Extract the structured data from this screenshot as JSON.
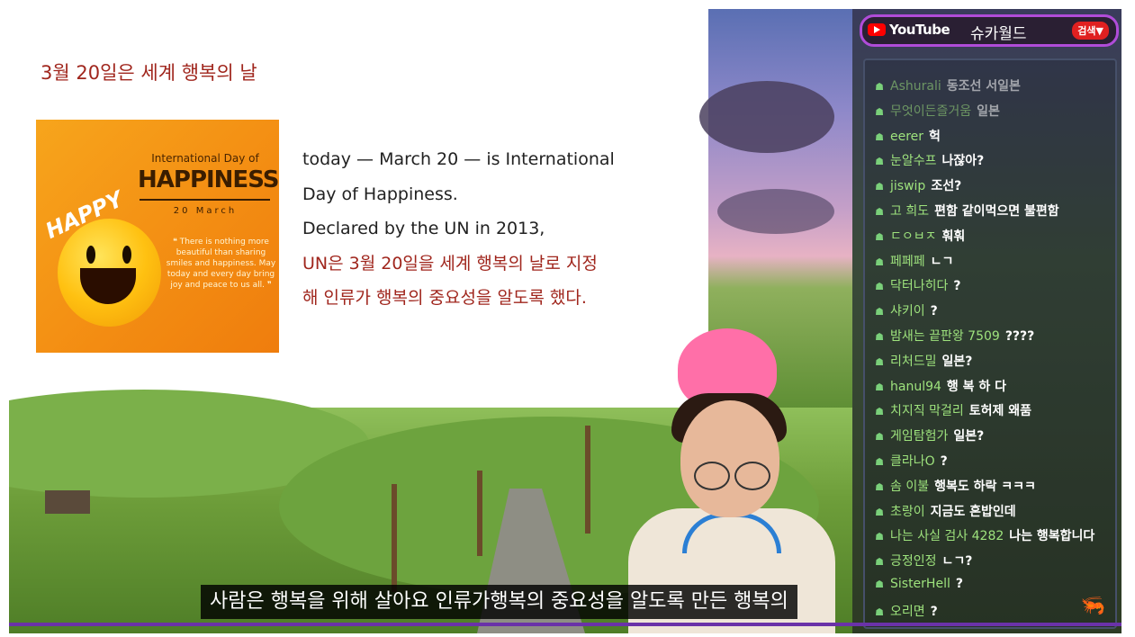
{
  "slide": {
    "title": "3월 20일은 세계 행복의 날",
    "poster": {
      "small_title": "International Day of",
      "big_title": "HAPPINESS",
      "date": "20 March",
      "quote": "❝ There is nothing more beautiful than sharing smiles and happiness. May today and every day bring joy and peace to us all. ❞",
      "happy_word": "HAPPY"
    },
    "lines": [
      "today — March 20 — is International",
      "Day of Happiness.",
      "Declared by the UN in 2013,",
      "UN은 3월 20일을 세계 행복의 날로 지정",
      "해 인류가 행복의 중요성을 알도록 했다."
    ]
  },
  "youtube": {
    "logo_text": "YouTube",
    "channel": "슈카월드",
    "search_label": "검색▼"
  },
  "chat": [
    {
      "user": "Ashurali",
      "msg": "동조선 서일본",
      "faded": true
    },
    {
      "user": "무엇이든즐거움",
      "msg": "일본",
      "faded": true
    },
    {
      "user": "eerer",
      "msg": "헉"
    },
    {
      "user": "눈알수프",
      "msg": "나잖아?"
    },
    {
      "user": "jiswip",
      "msg": "조선?"
    },
    {
      "user": "고 희도",
      "msg": "편함 같이먹으면 불편함"
    },
    {
      "user": "ㄷㅇㅂㅈ",
      "msg": "훠훠"
    },
    {
      "user": "페페페",
      "msg": "ㄴㄱ"
    },
    {
      "user": "닥터나히다",
      "msg": "?"
    },
    {
      "user": "샤키이",
      "msg": "?"
    },
    {
      "user": "밤새는 끝판왕 7509",
      "msg": "????"
    },
    {
      "user": "리처드밀",
      "msg": "일본?"
    },
    {
      "user": "hanul94",
      "msg": "행 복 하 다"
    },
    {
      "user": "치지직 막걸리",
      "msg": "토허제 왜품"
    },
    {
      "user": "게임탐험가",
      "msg": "일본?"
    },
    {
      "user": "클라나O",
      "msg": "?"
    },
    {
      "user": "솜 이불",
      "msg": "행복도 하락 ㅋㅋㅋ"
    },
    {
      "user": "초랑이",
      "msg": "지금도 혼밥인데"
    },
    {
      "user": "나는 사실 검사 4282",
      "msg": "나는 행복합니다"
    },
    {
      "user": "긍정인정",
      "msg": "ㄴㄱ?"
    },
    {
      "user": "SisterHell",
      "msg": "?"
    },
    {
      "user": "오리면",
      "msg": "?"
    }
  ],
  "subtitle": "사람은 행복을 위해 살아요 인류가행복의 중요성을 알도록 만든 행복의",
  "colors": {
    "accent_purple": "#b04cd8",
    "slide_red": "#a0261d",
    "chat_user": "#9ee37d"
  }
}
